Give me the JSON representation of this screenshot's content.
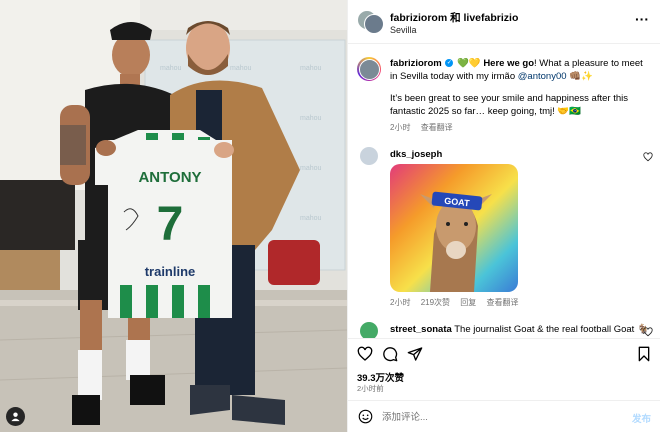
{
  "header": {
    "title": "fabriziorom 和 livefabrizio",
    "location": "Sevilla"
  },
  "caption": {
    "username": "fabriziorom",
    "line1_prefix": "💚💛 ",
    "line1_bold": "Here we go",
    "line1_suffix": "! What a pleasure to meet in Sevilla today with my irmão ",
    "mention": "@antony00",
    "line1_end": " 👊🏽✨",
    "body": "It’s been great to see your smile and happiness after this fantastic 2025 so far… keep going, tmj! 🤝🇧🇷",
    "time": "2小时",
    "translate": "查看翻译"
  },
  "comments": [
    {
      "username": "dks_joseph",
      "time": "2小时",
      "likes": "219次赞",
      "reply": "回复",
      "translate": "查看翻译",
      "image_text": "GOAT"
    },
    {
      "username": "street_sonata",
      "text": "The journalist Goat & the real football Goat 🐐"
    }
  ],
  "photo": {
    "jersey_name": "ANTONY",
    "jersey_number": "7",
    "sponsor": "trainline",
    "wall_brand": "mahou"
  },
  "stats": {
    "likes": "39.3万次赞",
    "time_ago": "2小时前"
  },
  "comment_box": {
    "placeholder": "添加评论...",
    "post_label": "发布"
  },
  "colors": {
    "link": "#00376b",
    "verified": "#0095f6",
    "meta": "#737373",
    "post_disabled": "#b3dbff"
  },
  "icons": [
    "more-icon",
    "verified-icon",
    "heart-icon",
    "comment-icon",
    "share-icon",
    "bookmark-icon",
    "emoji-icon",
    "user-tag-icon"
  ]
}
